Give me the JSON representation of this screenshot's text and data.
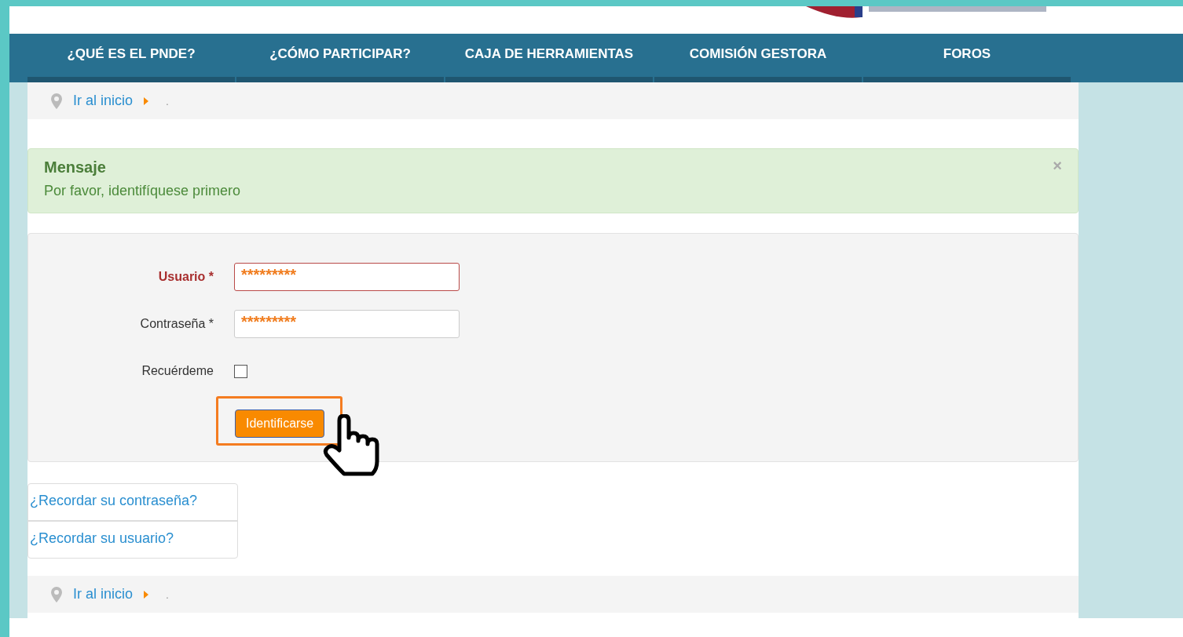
{
  "nav": {
    "items": [
      {
        "label": "¿QUÉ ES EL PNDE?"
      },
      {
        "label": "¿CÓMO PARTICIPAR?"
      },
      {
        "label": "CAJA DE HERRAMIENTAS"
      },
      {
        "label": "COMISIÓN GESTORA"
      },
      {
        "label": "FOROS"
      }
    ]
  },
  "breadcrumb_top": {
    "link": "Ir al inicio",
    "current": "."
  },
  "message": {
    "title": "Mensaje",
    "text": "Por favor, identifíquese primero",
    "close": "×"
  },
  "form": {
    "fields": [
      {
        "kind": "text",
        "label": "Usuario *",
        "value": "*********",
        "invalid": true
      },
      {
        "kind": "text",
        "label": "Contraseña *",
        "value": "*********",
        "invalid": false
      },
      {
        "kind": "checkbox",
        "label": "Recuérdeme",
        "checked": false
      }
    ],
    "submit": "Identificarse",
    "highlighted": true
  },
  "links": [
    {
      "label": "¿Recordar su contraseña?"
    },
    {
      "label": "¿Recordar su usuario?"
    }
  ],
  "breadcrumb_bottom": {
    "link": "Ir al inicio",
    "current": "."
  }
}
